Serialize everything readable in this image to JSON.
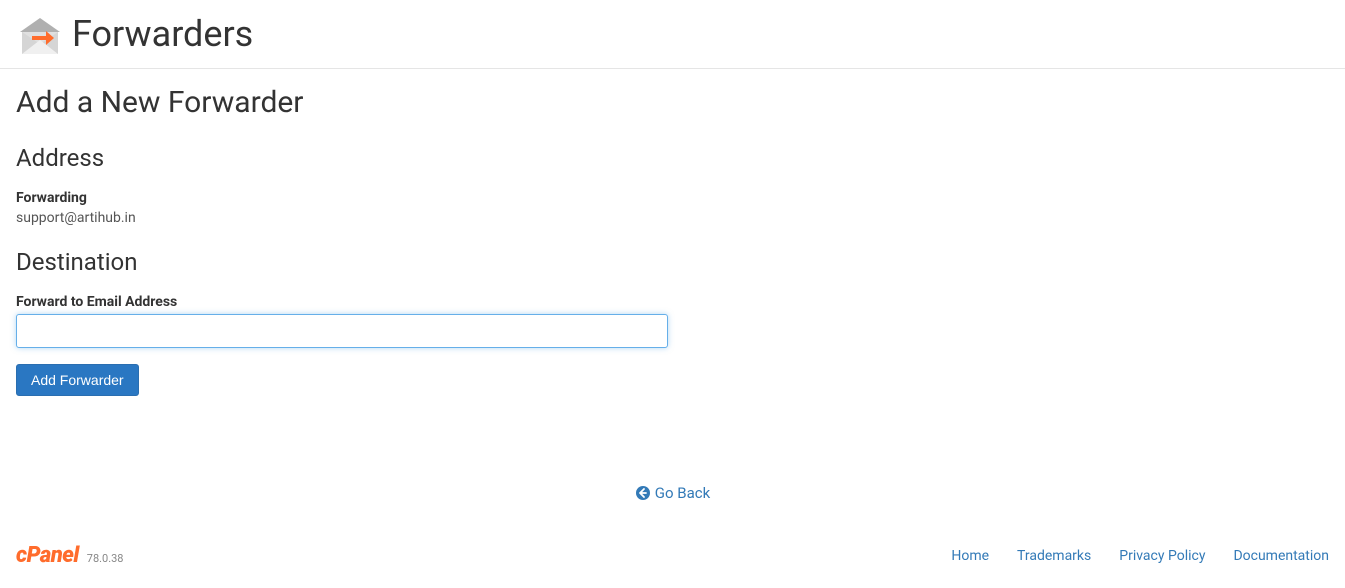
{
  "header": {
    "title": "Forwarders"
  },
  "section": {
    "title": "Add a New Forwarder"
  },
  "address": {
    "heading": "Address",
    "label": "Forwarding",
    "value": "support@artihub.in"
  },
  "destination": {
    "heading": "Destination",
    "label": "Forward to Email Address",
    "input_value": ""
  },
  "buttons": {
    "add_forwarder": "Add Forwarder"
  },
  "nav": {
    "go_back": "Go Back"
  },
  "footer": {
    "logo": "cPanel",
    "version": "78.0.38",
    "links": {
      "home": "Home",
      "trademarks": "Trademarks",
      "privacy": "Privacy Policy",
      "documentation": "Documentation"
    }
  }
}
